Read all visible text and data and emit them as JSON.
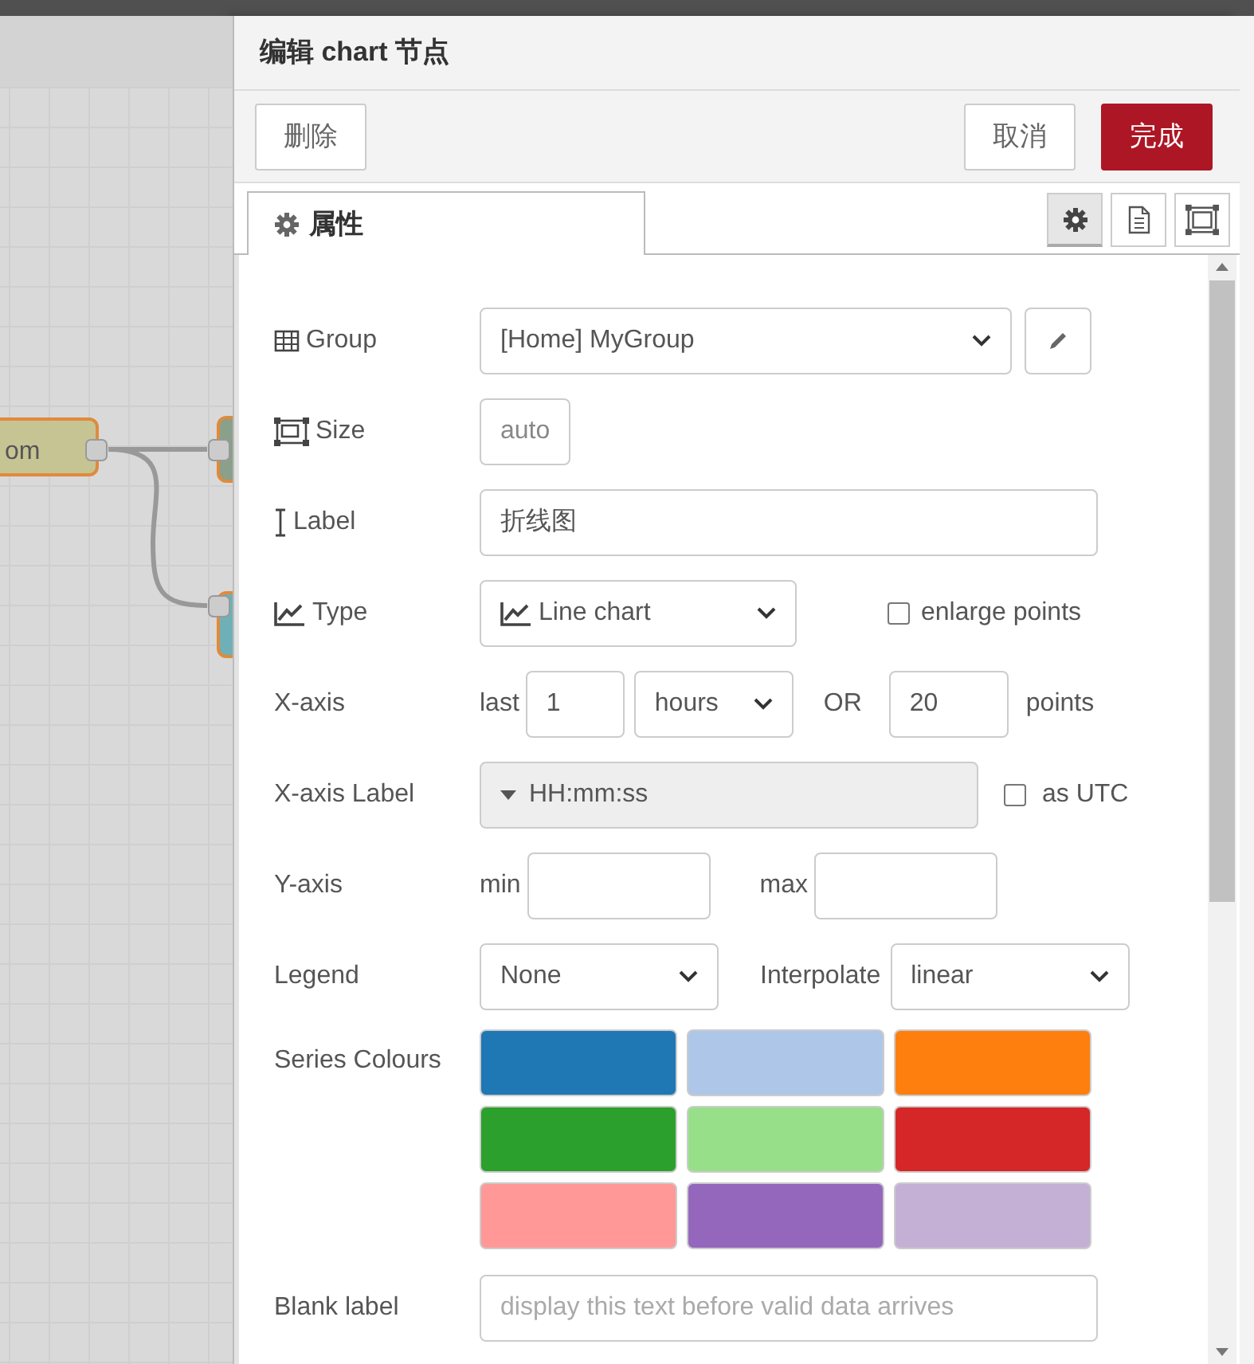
{
  "canvas": {
    "node_label": "om"
  },
  "dialog": {
    "title": "编辑 chart 节点",
    "delete_button": "删除",
    "cancel_button": "取消",
    "done_button": "完成"
  },
  "tabs": [
    {
      "label": "属性",
      "selected": true
    }
  ],
  "icon_tabs": [
    {
      "kind": "gear",
      "selected": true
    },
    {
      "kind": "document",
      "selected": false
    },
    {
      "kind": "frame",
      "selected": false
    }
  ],
  "form": {
    "group": {
      "label": "Group",
      "value": "[Home] MyGroup"
    },
    "size": {
      "label": "Size",
      "value": "auto"
    },
    "label": {
      "label": "Label",
      "value": "折线图"
    },
    "type": {
      "label": "Type",
      "value": "Line chart",
      "checkbox": {
        "label": "enlarge points",
        "checked": false
      }
    },
    "x_axis": {
      "label": "X-axis",
      "prefix": "last",
      "value": "1",
      "unit": "hours",
      "or": "OR",
      "points": "20",
      "suffix": "points"
    },
    "x_axis_label": {
      "label": "X-axis Label",
      "value": "HH:mm:ss",
      "checkbox": {
        "label": "as UTC",
        "checked": false
      }
    },
    "y_axis": {
      "label": "Y-axis",
      "min_label": "min",
      "max_label": "max"
    },
    "legend": {
      "label": "Legend",
      "value": "None",
      "interpolate_label": "Interpolate",
      "interpolate_value": "linear"
    },
    "series_colours": {
      "label": "Series Colours",
      "colors": [
        {
          "color": "#1f77b4"
        },
        {
          "color": "#aec7e8"
        },
        {
          "color": "#ff7f0e"
        },
        {
          "color": "#2ca02c"
        },
        {
          "color": "#98df8a"
        },
        {
          "color": "#d62728"
        },
        {
          "color": "#ff9896"
        },
        {
          "color": "#9467bd"
        },
        {
          "color": "#c5b0d5"
        }
      ]
    },
    "blank_label": {
      "label": "Blank label",
      "placeholder": "display this text before valid data arrives"
    }
  }
}
